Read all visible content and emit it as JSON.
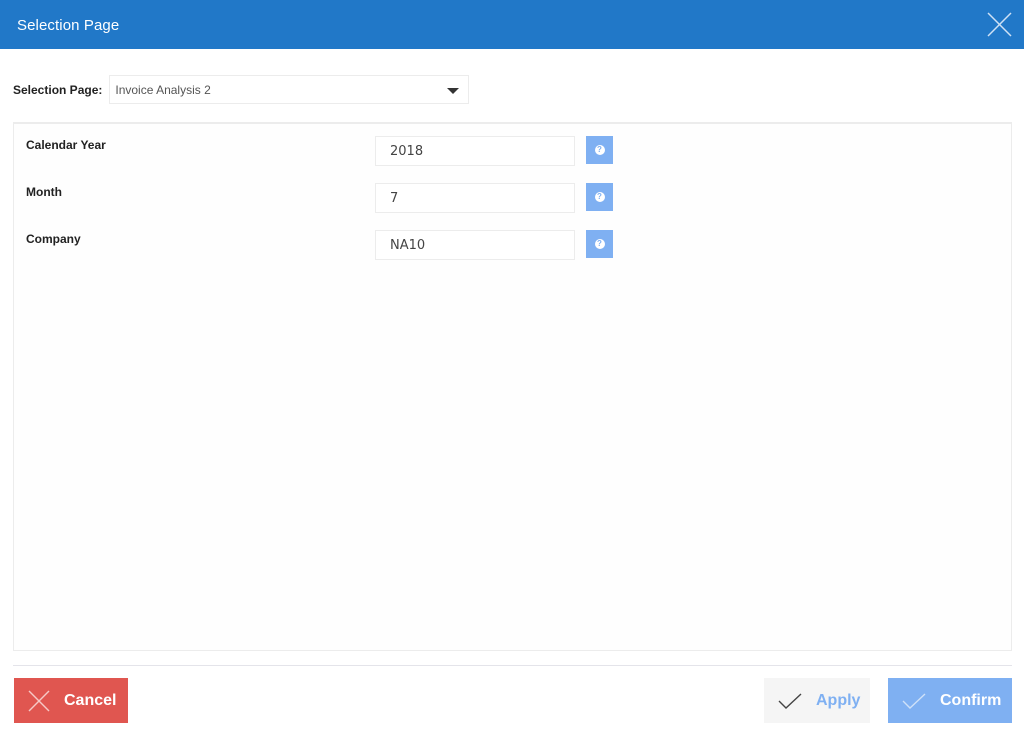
{
  "window": {
    "title": "Selection Page",
    "close_icon": "close-icon"
  },
  "selector": {
    "label": "Selection Page:",
    "selected": "Invoice Analysis 2",
    "caret_icon": "caret-down-icon"
  },
  "parameters": [
    {
      "label": "Calendar Year",
      "value": "2018",
      "help_icon": "help-icon"
    },
    {
      "label": "Month",
      "value": "7",
      "help_icon": "help-icon"
    },
    {
      "label": "Company",
      "value": "NA10",
      "help_icon": "help-icon"
    }
  ],
  "footer": {
    "cancel_label": "Cancel",
    "apply_label": "Apply",
    "confirm_label": "Confirm"
  },
  "colors": {
    "titlebar": "#2178c8",
    "cancel": "#e05650",
    "confirm": "#7fb0f2",
    "apply_bg": "#f5f5f5",
    "help": "#7fb0f2"
  }
}
